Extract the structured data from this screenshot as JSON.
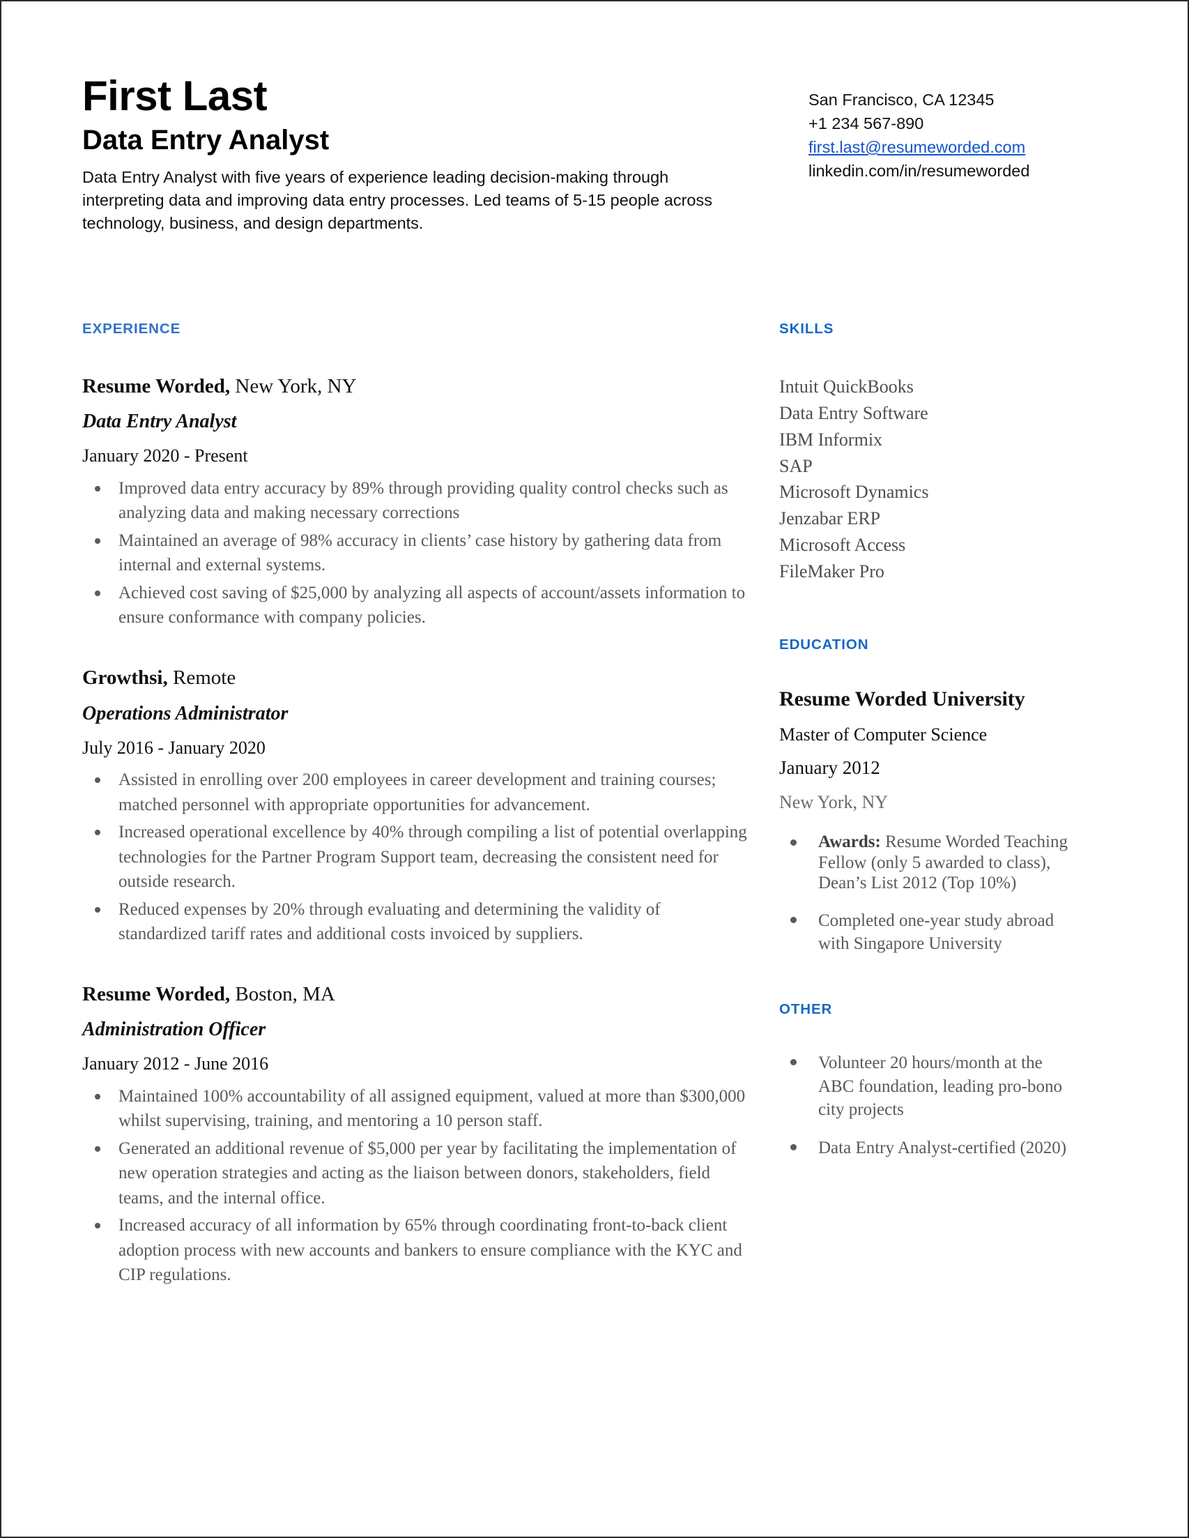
{
  "header": {
    "name": "First Last",
    "job_title": "Data Entry Analyst",
    "summary": "Data Entry Analyst with five years of experience leading decision-making through interpreting data and improving data entry processes. Led teams of 5-15 people across technology, business, and design departments.",
    "contact": {
      "location": "San Francisco, CA 12345",
      "phone": "+1 234 567-890",
      "email": "first.last@resumeworded.com",
      "linkedin": "linkedin.com/in/resumeworded"
    }
  },
  "colors": {
    "section_heading_blue": "#2f72c9",
    "link_blue": "#1155cc",
    "body_gray": "#595959",
    "heading_black": "#111111"
  },
  "experience": {
    "heading": "EXPERIENCE",
    "jobs": [
      {
        "company": "Resume Worded,",
        "location": " New York, NY",
        "role": "Data Entry Analyst",
        "dates": "January 2020 - Present",
        "bullets": [
          "Improved data entry accuracy by 89% through providing quality control checks such as analyzing data and making necessary corrections",
          "Maintained an average of 98% accuracy in clients’ case history by gathering data from internal and external systems.",
          "Achieved cost saving of $25,000 by analyzing all aspects of account/assets information to ensure conformance with company policies."
        ]
      },
      {
        "company": "Growthsi,",
        "location": " Remote",
        "role": "Operations Administrator",
        "dates": "July 2016 - January 2020",
        "bullets": [
          "Assisted in enrolling over 200 employees in career development and training courses; matched personnel with appropriate opportunities for advancement.",
          "Increased operational excellence by 40% through compiling a list of potential overlapping technologies for the Partner Program Support team, decreasing the consistent need for outside research.",
          "Reduced expenses by 20% through evaluating and determining the validity of standardized tariff rates and additional costs invoiced by suppliers."
        ]
      },
      {
        "company": "Resume Worded,",
        "location": " Boston, MA",
        "role": "Administration Officer",
        "dates": "January 2012 - June 2016",
        "bullets": [
          "Maintained 100% accountability of all assigned equipment, valued at more than $300,000 whilst supervising, training, and mentoring a 10 person staff.",
          "Generated an additional revenue of $5,000 per year by facilitating the implementation of new operation strategies and acting as the liaison between donors, stakeholders, field teams, and the internal office.",
          "Increased accuracy of all information by 65% through coordinating front-to-back client adoption process with new accounts and bankers to ensure compliance with the KYC and CIP regulations."
        ]
      }
    ]
  },
  "skills": {
    "heading": "SKILLS",
    "items": [
      "Intuit QuickBooks",
      "Data Entry Software",
      "IBM Informix",
      "SAP",
      "Microsoft Dynamics",
      "Jenzabar ERP",
      "Microsoft Access",
      "FileMaker Pro"
    ]
  },
  "education": {
    "heading": "EDUCATION",
    "school": "Resume Worded University",
    "degree": "Master of Computer Science",
    "date": "January 2012",
    "location": "New York, NY",
    "bullets": [
      {
        "label": "Awards:",
        "text": " Resume Worded Teaching Fellow (only 5 awarded to class), Dean’s List 2012 (Top 10%)"
      },
      {
        "label": "",
        "text": "Completed one-year study abroad with Singapore University"
      }
    ]
  },
  "other": {
    "heading": "OTHER",
    "bullets": [
      "Volunteer 20 hours/month at the ABC foundation, leading pro-bono city projects",
      "Data Entry Analyst-certified (2020)"
    ]
  }
}
